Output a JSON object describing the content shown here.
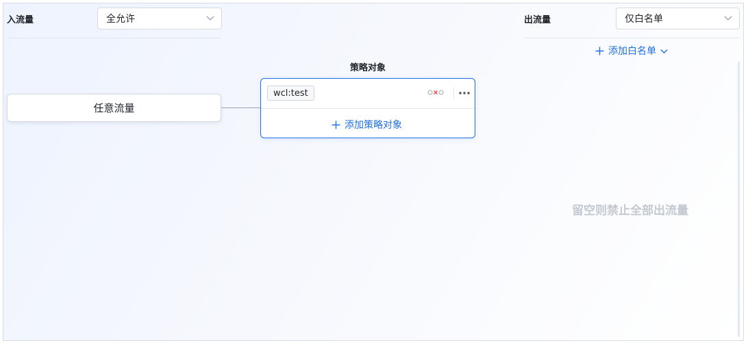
{
  "inbound": {
    "label": "入流量",
    "select_value": "全允许"
  },
  "outbound": {
    "label": "出流量",
    "select_value": "仅白名单",
    "add_whitelist_label": "添加白名单",
    "empty_hint": "留空则禁止全部出流量"
  },
  "source_node": {
    "label": "任意流量"
  },
  "policy": {
    "title": "策略对象",
    "tag": "wcl:test",
    "add_label": "添加策略对象"
  },
  "colors": {
    "accent": "#1f6fe0",
    "danger": "#e5484d",
    "muted": "#c4c9d1"
  },
  "icons": [
    "chevron-down-icon",
    "plus-icon",
    "unlink-icon",
    "more-icon"
  ]
}
